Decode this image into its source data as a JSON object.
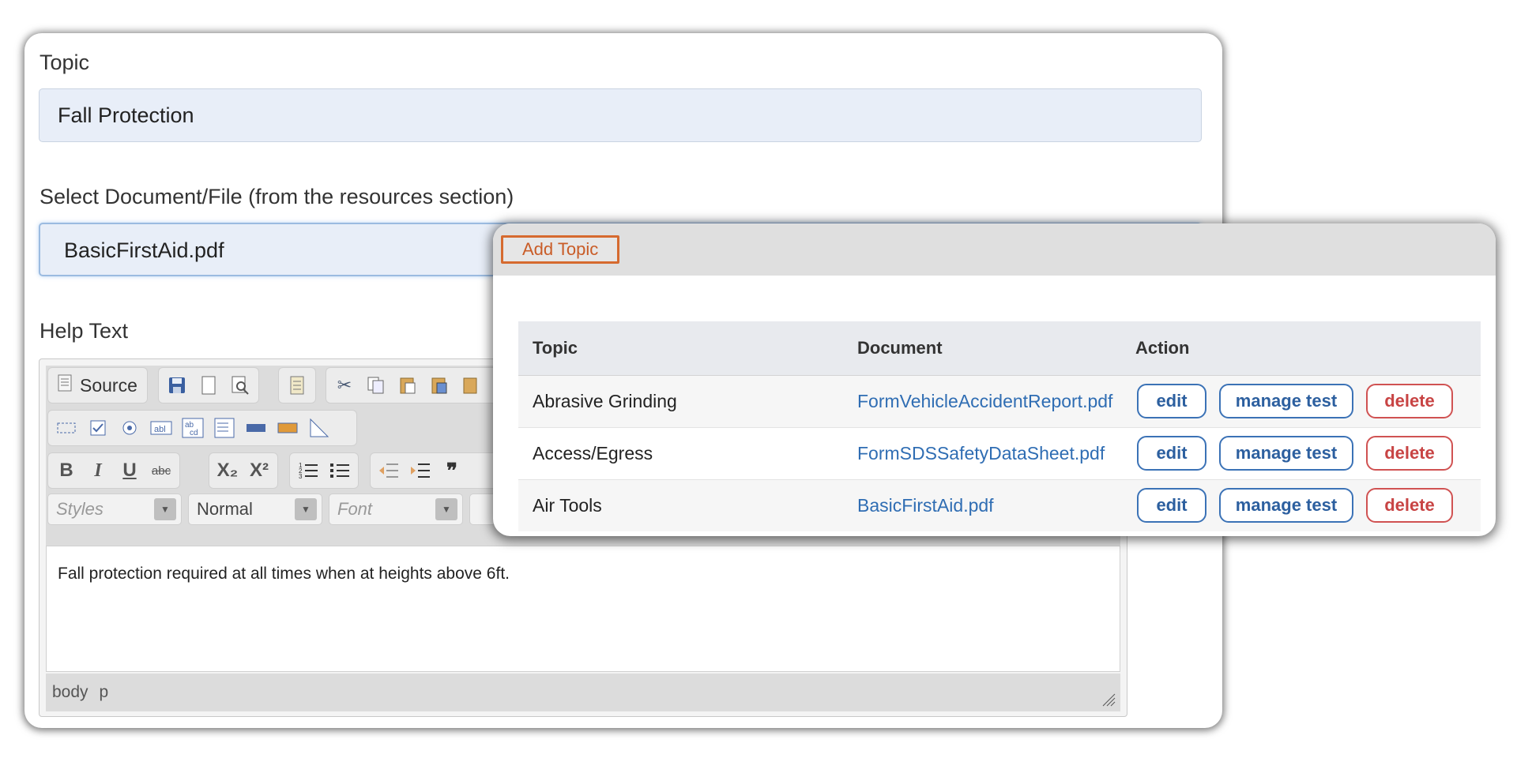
{
  "form": {
    "topic_label": "Topic",
    "topic_value": "Fall Protection",
    "doc_label": "Select Document/File (from the resources section)",
    "doc_value": "BasicFirstAid.pdf",
    "help_label": "Help Text",
    "editor": {
      "source_label": "Source",
      "styles_placeholder": "Styles",
      "format_value": "Normal",
      "font_placeholder": "Font",
      "body_text": "Fall protection required at all times when at heights above 6ft.",
      "status_path": [
        "body",
        "p"
      ],
      "icons": {
        "source": "document-icon",
        "save": "save-icon",
        "new_page": "new-page-icon",
        "preview": "preview-icon",
        "templates": "templates-icon",
        "cut": "cut-icon",
        "copy": "copy-icon",
        "paste": "paste-icon",
        "paste_text": "paste-text-icon",
        "paste_word": "paste-word-icon"
      },
      "format_buttons": [
        "B",
        "I",
        "U",
        "abc",
        "X₂",
        "X²"
      ]
    }
  },
  "list": {
    "add_topic_label": "Add Topic",
    "columns": [
      "Topic",
      "Document",
      "Action"
    ],
    "rows": [
      {
        "topic": "Abrasive Grinding",
        "document": "FormVehicleAccidentReport.pdf"
      },
      {
        "topic": "Access/Egress",
        "document": "FormSDSSafetyDataSheet.pdf"
      },
      {
        "topic": "Air Tools",
        "document": "BasicFirstAid.pdf"
      }
    ],
    "actions": {
      "edit": "edit",
      "manage": "manage test",
      "delete": "delete"
    }
  },
  "colors": {
    "accent_orange": "#d66a2f",
    "link_blue": "#2f6db3",
    "danger_red": "#d05252"
  }
}
